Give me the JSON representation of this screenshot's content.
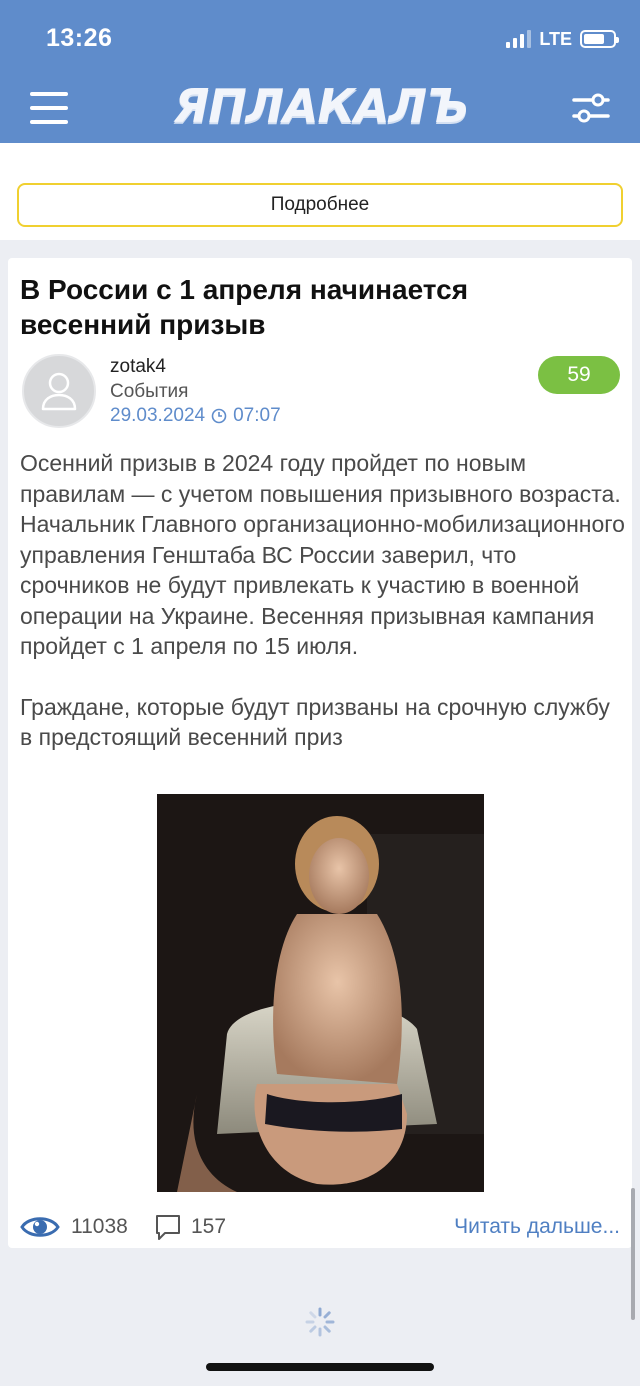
{
  "status_bar": {
    "time": "13:26",
    "network": "LTE",
    "battery_level": 0.7
  },
  "header": {
    "logo_text": "ЯПЛАКАЛЪ"
  },
  "top_card": {
    "more_button": "Подробнее"
  },
  "post": {
    "title": "В России с 1 апреля начинается весенний призыв",
    "author": "zotak4",
    "category": "События",
    "date": "29.03.2024",
    "time": "07:07",
    "rating": "59",
    "paragraphs": [
      "Осенний призыв в 2024 году пройдет по новым правилам — с учетом повышения призывного возраста. Начальник Главного организационно-мобилизационного управления Генштаба ВС России заверил, что срочников не будут привлекать к участию в военной операции на Украине. Весенняя призывная кампания пройдет с 1 апреля по 15 июля.",
      "Граждане, которые будут призваны на срочную службу в предстоящий весенний приз"
    ],
    "views": "11038",
    "comments": "157",
    "read_more": "Читать дальше..."
  },
  "colors": {
    "header": "#5f8ccb",
    "rating": "#7bc043",
    "button_border": "#f0d030",
    "link": "#4f7fc2"
  }
}
